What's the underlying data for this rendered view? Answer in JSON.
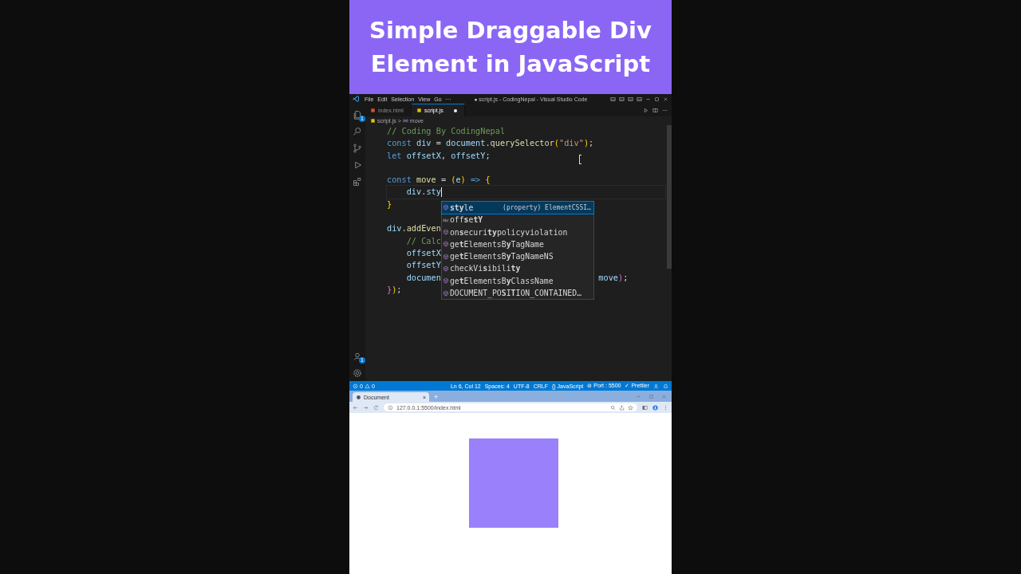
{
  "headline": "Simple Draggable Div Element in JavaScript",
  "window": {
    "title": "● script.js - CodingNepal - Visual Studio Code",
    "menu": [
      "File",
      "Edit",
      "Selection",
      "View",
      "Go",
      "···"
    ]
  },
  "tabs": [
    {
      "label": "index.html",
      "kind": "html",
      "selected": false,
      "modified": false
    },
    {
      "label": "script.js",
      "kind": "js",
      "selected": true,
      "modified": true
    }
  ],
  "breadcrumb": {
    "file": "script.js",
    "separator": ">",
    "symbol": "move"
  },
  "activity_bar": {
    "badges": {
      "explorer": "1",
      "accounts": "1"
    }
  },
  "editor": {
    "lines": [
      {
        "kind": "code",
        "tokens": [
          {
            "t": "// Coding By CodingNepal",
            "kind": "comment"
          }
        ]
      },
      {
        "kind": "code",
        "tokens": [
          {
            "t": "const",
            "kind": "kw"
          },
          {
            "t": " div",
            "kind": "var"
          },
          {
            "t": " = "
          },
          {
            "t": "document",
            "kind": "var"
          },
          {
            "t": "."
          },
          {
            "t": "querySelector",
            "kind": "fn"
          },
          {
            "t": "(",
            "kind": "br"
          },
          {
            "t": "\"div\"",
            "kind": "str"
          },
          {
            "t": ")",
            "kind": "br"
          },
          {
            "t": ";"
          }
        ]
      },
      {
        "kind": "code",
        "tokens": [
          {
            "t": "let",
            "kind": "kw"
          },
          {
            "t": " offsetX",
            "kind": "var"
          },
          {
            "t": ", "
          },
          {
            "t": "offsetY",
            "kind": "var"
          },
          {
            "t": ";"
          }
        ]
      },
      {
        "kind": "blank"
      },
      {
        "kind": "code",
        "tokens": [
          {
            "t": "const",
            "kind": "kw"
          },
          {
            "t": " move",
            "kind": "fn"
          },
          {
            "t": " = "
          },
          {
            "t": "(",
            "kind": "br"
          },
          {
            "t": "e",
            "kind": "var"
          },
          {
            "t": ")",
            "kind": "br"
          },
          {
            "t": " =>",
            "kind": "kw"
          },
          {
            "t": " {",
            "kind": "br"
          }
        ]
      },
      {
        "kind": "code",
        "current": true,
        "tokens": [
          {
            "t": "    div",
            "kind": "var"
          },
          {
            "t": "."
          },
          {
            "t": "sty",
            "kind": "var"
          }
        ]
      },
      {
        "kind": "code",
        "tokens": [
          {
            "t": "}",
            "kind": "br"
          }
        ]
      },
      {
        "kind": "blank"
      },
      {
        "kind": "code",
        "tokens": [
          {
            "t": "div",
            "kind": "var"
          },
          {
            "t": "."
          },
          {
            "t": "addEven",
            "kind": "fn"
          }
        ]
      },
      {
        "kind": "code",
        "tokens": [
          {
            "t": "    // Calc",
            "kind": "comment"
          }
        ]
      },
      {
        "kind": "code",
        "tokens": [
          {
            "t": "    offsetX",
            "kind": "var"
          }
        ]
      },
      {
        "kind": "code",
        "tokens": [
          {
            "t": "    offsetY",
            "kind": "var"
          }
        ]
      },
      {
        "kind": "code",
        "tokens": [
          {
            "t": "    documen",
            "kind": "var"
          }
        ],
        "after_popup": [
          {
            "t": "move",
            "kind": "var"
          },
          {
            "t": ")",
            "kind": "br2"
          },
          {
            "t": ";"
          }
        ]
      },
      {
        "kind": "code",
        "tokens": [
          {
            "t": "}",
            "kind": "br2"
          },
          {
            "t": ")",
            "kind": "br"
          },
          {
            "t": ";"
          }
        ]
      }
    ]
  },
  "suggestions": [
    {
      "label": "**sty**le",
      "kind": "property",
      "detail": "(property) ElementCSSI…",
      "selected": true
    },
    {
      "label": "off**s**e**tY**",
      "kind": "word",
      "selected": false
    },
    {
      "label": "on**s**ecuri**ty**policyviolation",
      "kind": "property",
      "selected": false
    },
    {
      "label": "ge**t**ElementsB**y**TagName",
      "kind": "property",
      "selected": false
    },
    {
      "label": "ge**t**ElementsB**y**TagNameNS",
      "kind": "property",
      "selected": false
    },
    {
      "label": "checkVi**s**ibili**ty**",
      "kind": "property",
      "selected": false
    },
    {
      "label": "ge**t**ElementsB**y**ClassName",
      "kind": "property",
      "selected": false
    },
    {
      "label": "DOCUMENT_PO**S**I**T**ION_CONTAINED…",
      "kind": "property",
      "selected": false
    }
  ],
  "status_bar": {
    "errors": "0",
    "warnings": "0",
    "items": [
      "Ln 6, Col 12",
      "Spaces: 4",
      "UTF-8",
      "CRLF",
      "{} JavaScript",
      "⊘ Port : 5500",
      "✓ Prettier"
    ]
  },
  "browser": {
    "tab": "Document",
    "close": "×",
    "new_tab": "+",
    "url": "127.0.0.1:5500/index.html"
  }
}
